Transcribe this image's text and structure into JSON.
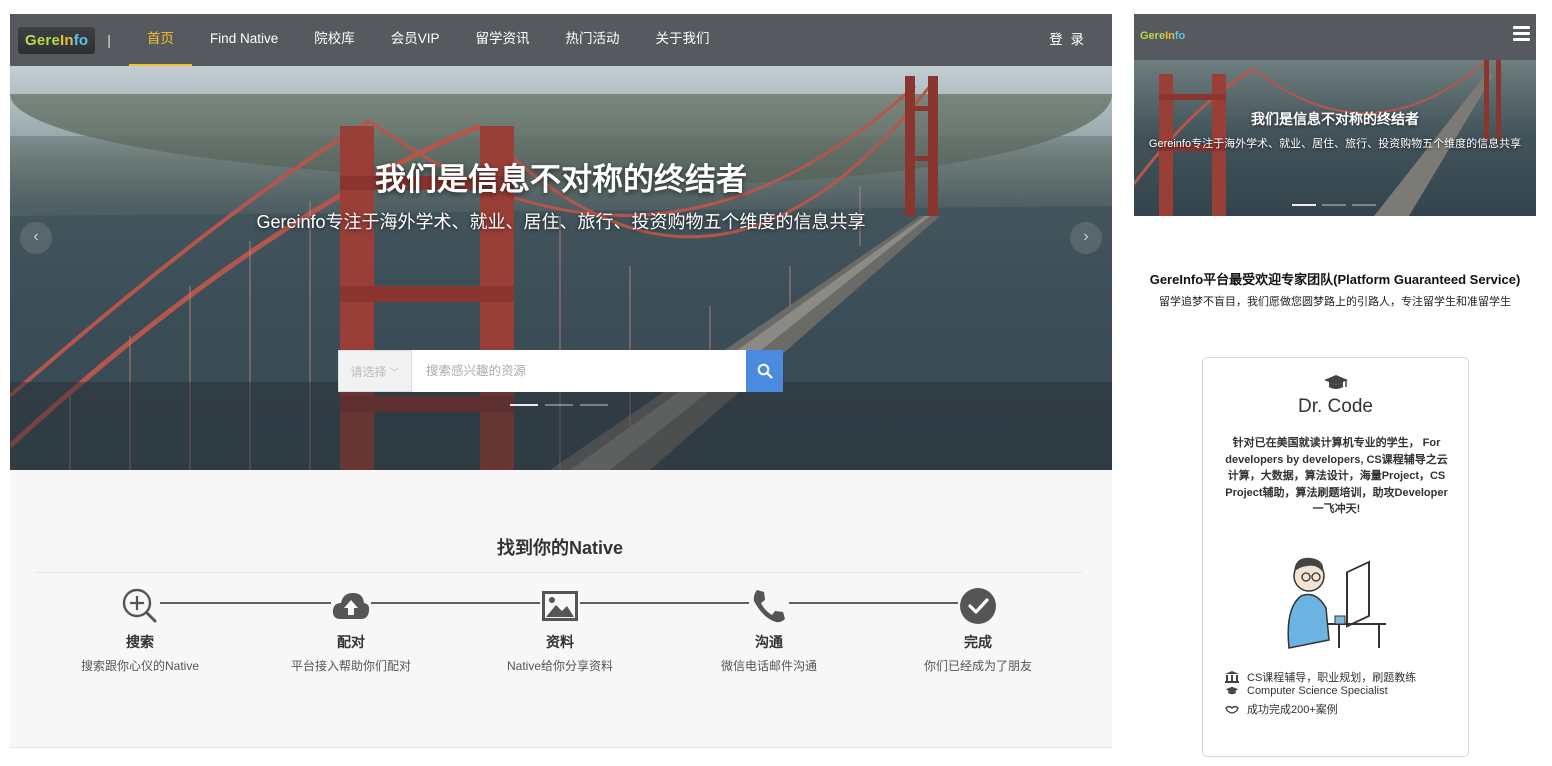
{
  "desktop": {
    "nav": {
      "logo": {
        "part1": "Gere",
        "part2": "In",
        "part3": "fo"
      },
      "separator": "|",
      "items": [
        {
          "label": "首页",
          "active": true
        },
        {
          "label": "Find Native",
          "active": false
        },
        {
          "label": "院校库",
          "active": false
        },
        {
          "label": "会员VIP",
          "active": false
        },
        {
          "label": "留学资讯",
          "active": false
        },
        {
          "label": "热门活动",
          "active": false
        },
        {
          "label": "关于我们",
          "active": false
        }
      ],
      "login_label": "登 录"
    },
    "hero": {
      "title": "我们是信息不对称的终结者",
      "subtitle": "Gereinfo专注于海外学术、就业、居住、旅行、投资购物五个维度的信息共享",
      "prev_arrow": "‹",
      "next_arrow": "›",
      "search": {
        "select_value": "请选择",
        "placeholder": "搜索感兴趣的资源"
      },
      "slides": {
        "count": 3,
        "active": 0
      }
    },
    "find": {
      "title": "找到你的Native",
      "steps": [
        {
          "icon": "magnify-plus-icon",
          "title": "搜索",
          "desc": "搜索跟你心仪的Native"
        },
        {
          "icon": "cloud-upload-icon",
          "title": "配对",
          "desc": "平台接入帮助你们配对"
        },
        {
          "icon": "image-icon",
          "title": "资料",
          "desc": "Native给你分享资料"
        },
        {
          "icon": "phone-icon",
          "title": "沟通",
          "desc": "微信电话邮件沟通"
        },
        {
          "icon": "check-circle-icon",
          "title": "完成",
          "desc": "你们已经成为了朋友"
        }
      ]
    },
    "colors": {
      "nav_bg": "#56595e",
      "accent": "#f2c230",
      "search_btn": "#4a8be0"
    }
  },
  "mobile": {
    "logo": {
      "part1": "Gere",
      "part2": "In",
      "part3": "fo"
    },
    "hero": {
      "title": "我们是信息不对称的终结者",
      "subtitle": "Gereinfo专注于海外学术、就业、居住、旅行、投资购物五个维度的信息共享"
    },
    "section": {
      "title": "GereInfo平台最受欢迎专家团队(Platform Guaranteed Service)",
      "subtitle": "留学追梦不盲目，我们愿做您圆梦路上的引路人，专注留学生和准留学生"
    },
    "card": {
      "name": "Dr. Code",
      "desc": "针对已在美国就读计算机专业的学生， For developers by developers, CS课程辅导之云计算，大数据，算法设计，海量Project，CS Project辅助，算法刷题培训，助攻Developer一飞冲天!",
      "features": [
        {
          "icon": "bank-icon",
          "text": "CS课程辅导，职业规划，刷题教练"
        },
        {
          "icon": "graduation-cap-icon",
          "text": "Computer Science Specialist"
        },
        {
          "icon": "handshake-icon",
          "text": "成功完成200+案例"
        }
      ]
    }
  }
}
